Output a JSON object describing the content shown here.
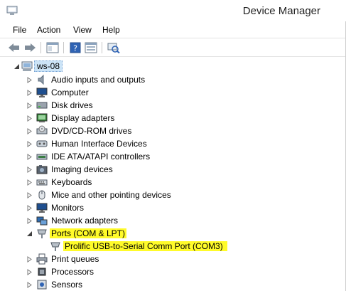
{
  "window": {
    "title": "Device Manager"
  },
  "menu": [
    "File",
    "Action",
    "View",
    "Help"
  ],
  "toolbar": {
    "buttons": [
      {
        "icon": "back-arrow-icon"
      },
      {
        "icon": "forward-arrow-icon"
      },
      {
        "icon": "show-hide-console-tree-icon"
      },
      {
        "icon": "help-icon"
      },
      {
        "icon": "properties-icon"
      },
      {
        "icon": "scan-hardware-icon"
      }
    ]
  },
  "tree": {
    "root": {
      "label": "ws-08",
      "icon": "computer-icon",
      "expanded": true
    },
    "items": [
      {
        "label": "Audio inputs and outputs",
        "icon": "speaker-icon",
        "expanded": false
      },
      {
        "label": "Computer",
        "icon": "monitor-icon",
        "expanded": false
      },
      {
        "label": "Disk drives",
        "icon": "disk-drive-icon",
        "expanded": false
      },
      {
        "label": "Display adapters",
        "icon": "display-adapter-icon",
        "expanded": false
      },
      {
        "label": "DVD/CD-ROM drives",
        "icon": "optical-drive-icon",
        "expanded": false
      },
      {
        "label": "Human Interface Devices",
        "icon": "hid-icon",
        "expanded": false
      },
      {
        "label": "IDE ATA/ATAPI controllers",
        "icon": "ide-controller-icon",
        "expanded": false
      },
      {
        "label": "Imaging devices",
        "icon": "camera-icon",
        "expanded": false
      },
      {
        "label": "Keyboards",
        "icon": "keyboard-icon",
        "expanded": false
      },
      {
        "label": "Mice and other pointing devices",
        "icon": "mouse-icon",
        "expanded": false
      },
      {
        "label": "Monitors",
        "icon": "monitor-icon",
        "expanded": false
      },
      {
        "label": "Network adapters",
        "icon": "network-adapter-icon",
        "expanded": false
      },
      {
        "label": "Ports (COM & LPT)",
        "icon": "port-icon",
        "expanded": true,
        "highlighted": true,
        "children": [
          {
            "label": "Prolific USB-to-Serial Comm Port (COM3)",
            "icon": "port-icon",
            "highlighted": true
          }
        ]
      },
      {
        "label": "Print queues",
        "icon": "printer-icon",
        "expanded": false
      },
      {
        "label": "Processors",
        "icon": "processor-icon",
        "expanded": false
      },
      {
        "label": "Sensors",
        "icon": "sensor-icon",
        "expanded": false
      }
    ]
  },
  "colors": {
    "highlight": "#fffb2a",
    "selection": "#cce4f7"
  }
}
